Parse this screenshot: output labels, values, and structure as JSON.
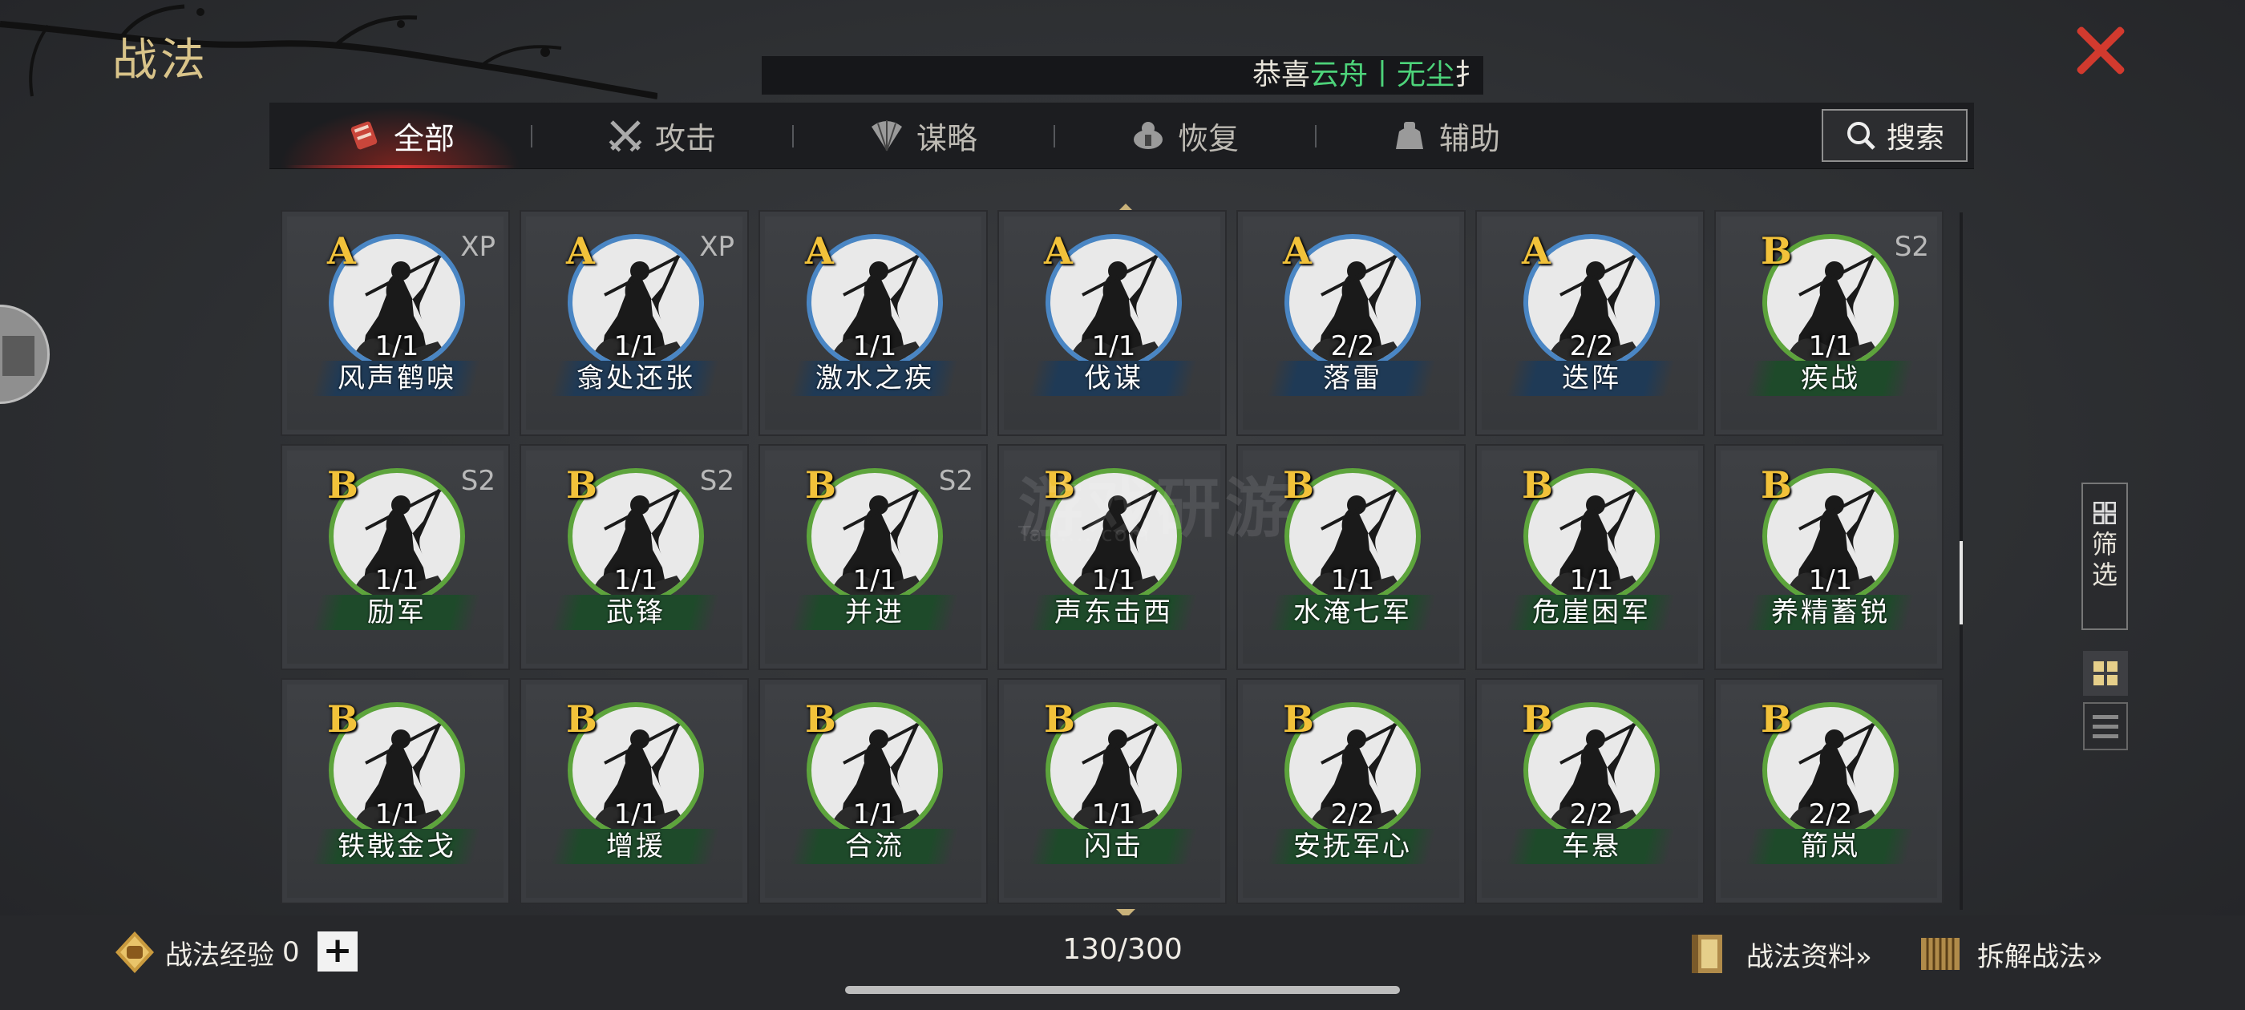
{
  "window": {
    "title": "战法",
    "close_icon": "close-icon"
  },
  "ticker": {
    "prefix": "恭喜",
    "highlight": "云舟丨无尘",
    "tail": "扌"
  },
  "tabs": [
    {
      "label": "全部",
      "icon": "all-skills-icon",
      "active": true
    },
    {
      "label": "攻击",
      "icon": "crossed-swords-icon",
      "active": false
    },
    {
      "label": "谋略",
      "icon": "strategy-fan-icon",
      "active": false
    },
    {
      "label": "恢复",
      "icon": "recovery-icon",
      "active": false
    },
    {
      "label": "辅助",
      "icon": "support-bag-icon",
      "active": false
    }
  ],
  "search": {
    "label": "搜索",
    "icon": "search-icon"
  },
  "cards": [
    {
      "grade": "A",
      "tag": "XP",
      "count": "1/1",
      "name": "风声鹤唳",
      "color": "blue"
    },
    {
      "grade": "A",
      "tag": "XP",
      "count": "1/1",
      "name": "翕处还张",
      "color": "blue"
    },
    {
      "grade": "A",
      "tag": "",
      "count": "1/1",
      "name": "激水之疾",
      "color": "blue"
    },
    {
      "grade": "A",
      "tag": "",
      "count": "1/1",
      "name": "伐谋",
      "color": "blue"
    },
    {
      "grade": "A",
      "tag": "",
      "count": "2/2",
      "name": "落雷",
      "color": "blue"
    },
    {
      "grade": "A",
      "tag": "",
      "count": "2/2",
      "name": "迭阵",
      "color": "blue"
    },
    {
      "grade": "B",
      "tag": "S2",
      "count": "1/1",
      "name": "疾战",
      "color": "green"
    },
    {
      "grade": "B",
      "tag": "S2",
      "count": "1/1",
      "name": "励军",
      "color": "green"
    },
    {
      "grade": "B",
      "tag": "S2",
      "count": "1/1",
      "name": "武锋",
      "color": "green"
    },
    {
      "grade": "B",
      "tag": "S2",
      "count": "1/1",
      "name": "并进",
      "color": "green"
    },
    {
      "grade": "B",
      "tag": "",
      "count": "1/1",
      "name": "声东击西",
      "color": "green"
    },
    {
      "grade": "B",
      "tag": "",
      "count": "1/1",
      "name": "水淹七军",
      "color": "green"
    },
    {
      "grade": "B",
      "tag": "",
      "count": "1/1",
      "name": "危崖困军",
      "color": "green"
    },
    {
      "grade": "B",
      "tag": "",
      "count": "1/1",
      "name": "养精蓄锐",
      "color": "green"
    },
    {
      "grade": "B",
      "tag": "",
      "count": "1/1",
      "name": "铁戟金戈",
      "color": "green"
    },
    {
      "grade": "B",
      "tag": "",
      "count": "1/1",
      "name": "增援",
      "color": "green"
    },
    {
      "grade": "B",
      "tag": "",
      "count": "1/1",
      "name": "合流",
      "color": "green"
    },
    {
      "grade": "B",
      "tag": "",
      "count": "1/1",
      "name": "闪击",
      "color": "green"
    },
    {
      "grade": "B",
      "tag": "",
      "count": "2/2",
      "name": "安抚军心",
      "color": "green"
    },
    {
      "grade": "B",
      "tag": "",
      "count": "2/2",
      "name": "车悬",
      "color": "green"
    },
    {
      "grade": "B",
      "tag": "",
      "count": "2/2",
      "name": "箭岚",
      "color": "green"
    }
  ],
  "watermark": {
    "text": "游戏研游",
    "sub": "Ta.......com"
  },
  "side": {
    "filter_label_1": "筛",
    "filter_label_2": "选",
    "filter_icon": "filter-grid-icon",
    "grid_view_icon": "grid-view-icon",
    "list_view_icon": "list-view-icon"
  },
  "bottom": {
    "exp_label": "战法经验",
    "exp_value": "0",
    "plus_label": "+",
    "capacity": "130/300",
    "info_link": "战法资料»",
    "dismantle_link": "拆解战法»"
  },
  "colors": {
    "accent_gold": "#d9c48a",
    "close_red": "#d23a2e",
    "highlight_green": "#4dd37a",
    "ring_blue": "#4a86c4",
    "ring_green": "#5da43c"
  }
}
